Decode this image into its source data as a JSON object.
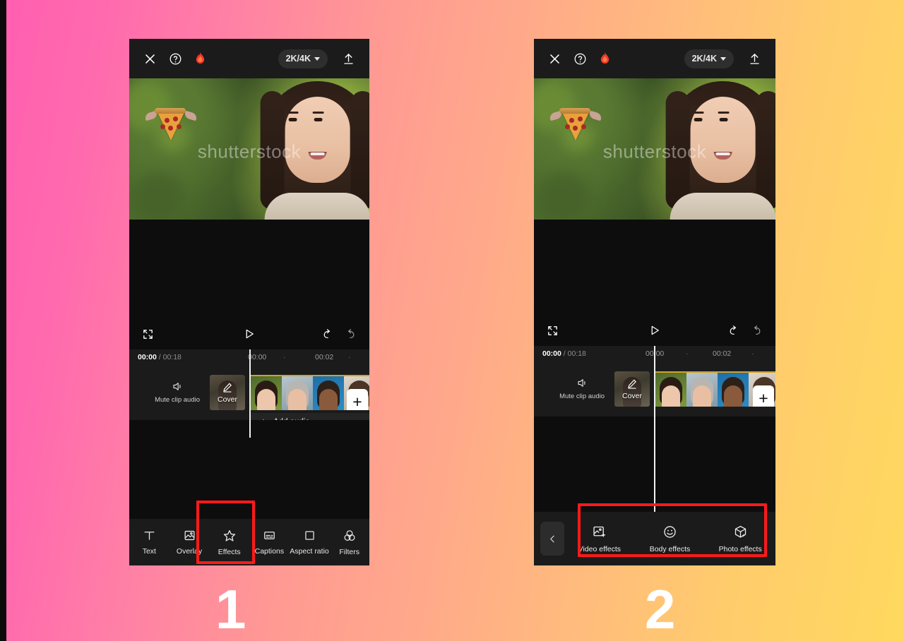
{
  "background": {
    "gradient_from": "#FF5FB0",
    "gradient_mid": "#FFA98A",
    "gradient_to": "#FFD95E"
  },
  "highlight_color": "#FF1A1A",
  "panels": [
    {
      "step_number": "1",
      "topbar": {
        "close_icon": "close-x-icon",
        "help_icon": "question-circle-icon",
        "flame_icon": "flame-icon",
        "resolution_label": "2K/4K",
        "export_icon": "upload-arrow-icon"
      },
      "preview": {
        "watermark": "shutterstock",
        "sticker": "flying-pizza-sticker"
      },
      "playback": {
        "fullscreen_icon": "expand-icon",
        "play_icon": "play-triangle-icon",
        "undo_icon": "undo-arrow-icon",
        "redo_icon": "redo-arrow-icon"
      },
      "timeline": {
        "current_time": "00:00",
        "separator": "/",
        "total_time": "00:18",
        "ticks": [
          "00:00",
          "·",
          "00:02",
          "·"
        ],
        "mute_label": "Mute clip audio",
        "cover_label": "Cover",
        "add_clip_label": "+",
        "add_audio_label": "Add audio"
      },
      "toolbar": [
        {
          "label": "Text",
          "icon": "text-t-icon",
          "highlighted": false
        },
        {
          "label": "Overlay",
          "icon": "overlay-image-icon",
          "highlighted": false
        },
        {
          "label": "Effects",
          "icon": "effects-star-icon",
          "highlighted": true
        },
        {
          "label": "Captions",
          "icon": "captions-icon",
          "highlighted": false
        },
        {
          "label": "Aspect ratio",
          "icon": "aspect-ratio-square-icon",
          "highlighted": false
        },
        {
          "label": "Filters",
          "icon": "filters-circles-icon",
          "highlighted": false
        }
      ]
    },
    {
      "step_number": "2",
      "topbar": {
        "close_icon": "close-x-icon",
        "help_icon": "question-circle-icon",
        "flame_icon": "flame-icon",
        "resolution_label": "2K/4K",
        "export_icon": "upload-arrow-icon"
      },
      "preview": {
        "watermark": "shutterstock",
        "sticker": "flying-pizza-sticker"
      },
      "playback": {
        "fullscreen_icon": "expand-icon",
        "play_icon": "play-triangle-icon",
        "undo_icon": "undo-arrow-icon",
        "redo_icon": "redo-arrow-icon"
      },
      "timeline": {
        "current_time": "00:00",
        "separator": "/",
        "total_time": "00:18",
        "ticks": [
          "00:00",
          "·",
          "00:02",
          "·"
        ],
        "mute_label": "Mute clip audio",
        "cover_label": "Cover",
        "add_clip_label": "+"
      },
      "effects_menu": {
        "back_icon": "chevron-left-icon",
        "items": [
          {
            "label": "Video effects",
            "icon": "video-effects-icon"
          },
          {
            "label": "Body effects",
            "icon": "body-effects-smiley-icon"
          },
          {
            "label": "Photo effects",
            "icon": "photo-effects-cube-icon"
          }
        ]
      }
    }
  ]
}
